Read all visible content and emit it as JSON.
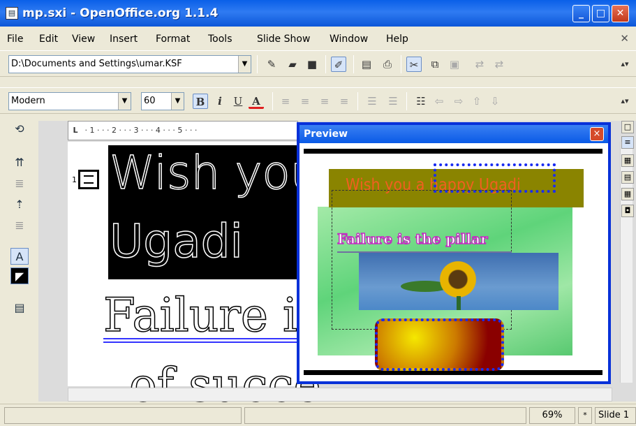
{
  "window": {
    "title": "mp.sxi - OpenOffice.org 1.1.4",
    "app_icon": "document-icon"
  },
  "menu": [
    "File",
    "Edit",
    "View",
    "Insert",
    "Format",
    "Tools",
    "Slide Show",
    "Window",
    "Help"
  ],
  "toolbar1": {
    "path": "D:\\Documents and Settings\\umar.KSF"
  },
  "toolbar2": {
    "font": "Modern",
    "size": "60",
    "bold": "B",
    "italic": "i",
    "underline": "U",
    "color": "A"
  },
  "ruler": {
    "corner": "L",
    "ticks": "· 1 · · · 2 · · · 3 · · · 4 · · · 5 · · ·"
  },
  "slide_outline": {
    "bullet_number": "1",
    "title_line1": "Wish you",
    "title_line2": "Ugadi",
    "body_line1": "Failure i",
    "body_line2": "of succe"
  },
  "preview": {
    "title": "Preview",
    "close": "×",
    "wish_text": "Wish you a happy Ugadi",
    "failure_text": "Failure is the pillar"
  },
  "status": {
    "zoom": "69%",
    "mode": "*",
    "slide": "Slide 1"
  }
}
